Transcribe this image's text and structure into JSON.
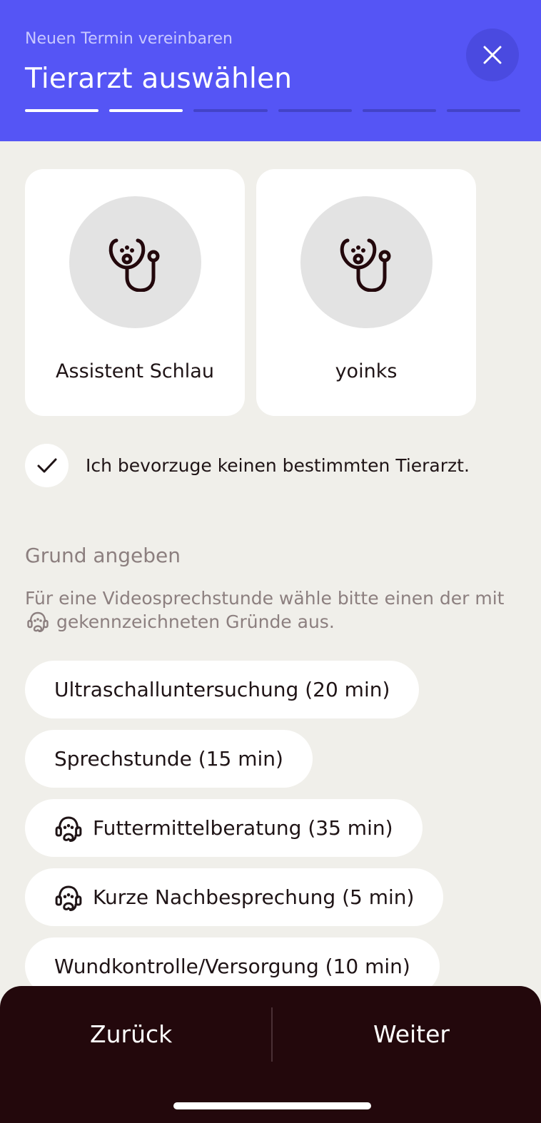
{
  "header": {
    "subtitle": "Neuen Termin vereinbaren",
    "title": "Tierarzt auswählen",
    "progress": {
      "total_steps": 6,
      "completed_steps": 2
    },
    "close_icon": "close-icon"
  },
  "vets": [
    {
      "name": "Assistent Schlau",
      "icon": "stethoscope-icon"
    },
    {
      "name": "yoinks",
      "icon": "stethoscope-icon"
    }
  ],
  "no_preference": {
    "label": "Ich bevorzuge keinen bestimmten Tierarzt.",
    "checked": true
  },
  "reason": {
    "title": "Grund angeben",
    "hint_before": "Für eine Videosprechstunde wähle bitte einen der mit",
    "hint_after": "gekennzeichneten Gründe aus.",
    "options": [
      {
        "label": "Ultraschalluntersuchung (20 min)",
        "video": false
      },
      {
        "label": "Sprechstunde (15 min)",
        "video": false
      },
      {
        "label": "Futtermittelberatung (35 min)",
        "video": true
      },
      {
        "label": "Kurze Nachbesprechung (5 min)",
        "video": true
      },
      {
        "label": "Wundkontrolle/Versorgung (10 min)",
        "video": false
      }
    ]
  },
  "footer": {
    "back_label": "Zurück",
    "next_label": "Weiter"
  },
  "colors": {
    "header_bg": "#5555f5",
    "page_bg": "#f0efea",
    "footer_bg": "#23080c",
    "text_dark": "#1f1416",
    "text_muted": "#8c7f7f"
  }
}
